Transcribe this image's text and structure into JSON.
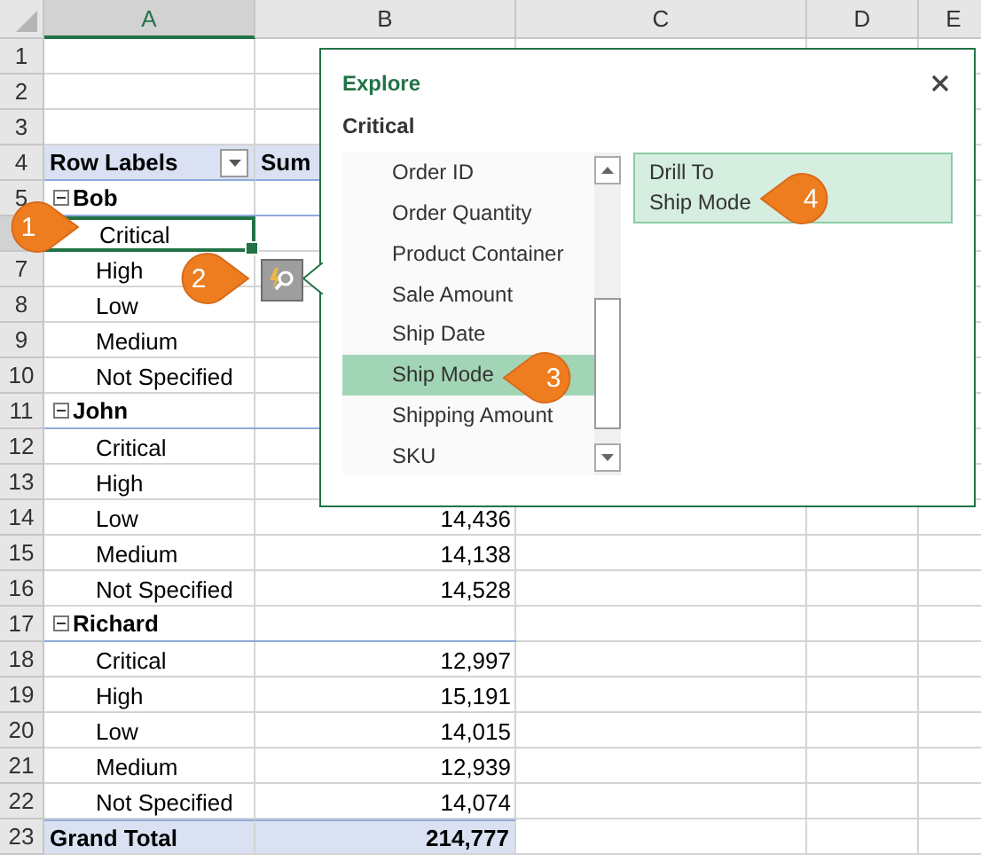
{
  "columns": [
    {
      "label": "A",
      "selected": true
    },
    {
      "label": "B",
      "selected": false
    },
    {
      "label": "C",
      "selected": false
    },
    {
      "label": "D",
      "selected": false
    },
    {
      "label": "E",
      "selected": false
    }
  ],
  "row_numbers": [
    {
      "label": "1",
      "selected": false
    },
    {
      "label": "2",
      "selected": false
    },
    {
      "label": "3",
      "selected": false
    },
    {
      "label": "4",
      "selected": false
    },
    {
      "label": "5",
      "selected": false
    },
    {
      "selected": true
    },
    {
      "label": "7",
      "selected": false
    },
    {
      "label": "8",
      "selected": false
    },
    {
      "label": "9",
      "selected": false
    },
    {
      "label": "10",
      "selected": false
    },
    {
      "label": "11",
      "selected": false
    },
    {
      "label": "12",
      "selected": false
    },
    {
      "label": "13",
      "selected": false
    },
    {
      "label": "14",
      "selected": false
    },
    {
      "label": "15",
      "selected": false
    },
    {
      "label": "16",
      "selected": false
    },
    {
      "label": "17",
      "selected": false
    },
    {
      "label": "18",
      "selected": false
    },
    {
      "label": "19",
      "selected": false
    },
    {
      "label": "20",
      "selected": false
    },
    {
      "label": "21",
      "selected": false
    },
    {
      "label": "22",
      "selected": false
    },
    {
      "label": "23",
      "selected": false
    }
  ],
  "pivot": {
    "header": {
      "label": "Row Labels",
      "value": "Sum"
    },
    "groups": [
      {
        "name": "Bob",
        "expanded": true,
        "items": [
          {
            "label": "Critical",
            "selected": true
          },
          {
            "label": "High",
            "selected": false
          },
          {
            "label": "Low",
            "selected": false
          },
          {
            "label": "Medium",
            "selected": false
          },
          {
            "label": "Not Specified",
            "selected": false
          }
        ]
      },
      {
        "name": "John",
        "expanded": true,
        "items": [
          {
            "label": "Critical",
            "selected": false
          },
          {
            "label": "High",
            "selected": false
          },
          {
            "label": "Low",
            "value": "14,436",
            "selected": false
          },
          {
            "label": "Medium",
            "value": "14,138",
            "selected": false
          },
          {
            "label": "Not Specified",
            "value": "14,528",
            "selected": false
          }
        ]
      },
      {
        "name": "Richard",
        "expanded": true,
        "items": [
          {
            "label": "Critical",
            "value": "12,997",
            "selected": false
          },
          {
            "label": "High",
            "value": "15,191",
            "selected": false
          },
          {
            "label": "Low",
            "value": "14,015",
            "selected": false
          },
          {
            "label": "Medium",
            "value": "12,939",
            "selected": false
          },
          {
            "label": "Not Specified",
            "value": "14,074",
            "selected": false
          }
        ]
      }
    ],
    "grand_total": {
      "label": "Grand Total",
      "value": "214,777"
    }
  },
  "explore": {
    "title": "Explore",
    "context": "Critical",
    "fields": [
      {
        "label": "Order ID",
        "selected": false
      },
      {
        "label": "Order Quantity",
        "selected": false
      },
      {
        "label": "Product Container",
        "selected": false
      },
      {
        "label": "Sale Amount",
        "selected": false
      },
      {
        "label": "Ship Date",
        "selected": false
      },
      {
        "label": "Ship Mode",
        "selected": true
      },
      {
        "label": "Shipping Amount",
        "selected": false
      },
      {
        "label": "SKU",
        "selected": false
      }
    ],
    "action_lines": [
      "Drill To",
      "Ship Mode"
    ]
  },
  "callouts": [
    {
      "label": "1"
    },
    {
      "label": "2"
    },
    {
      "label": "3"
    },
    {
      "label": "4"
    }
  ]
}
